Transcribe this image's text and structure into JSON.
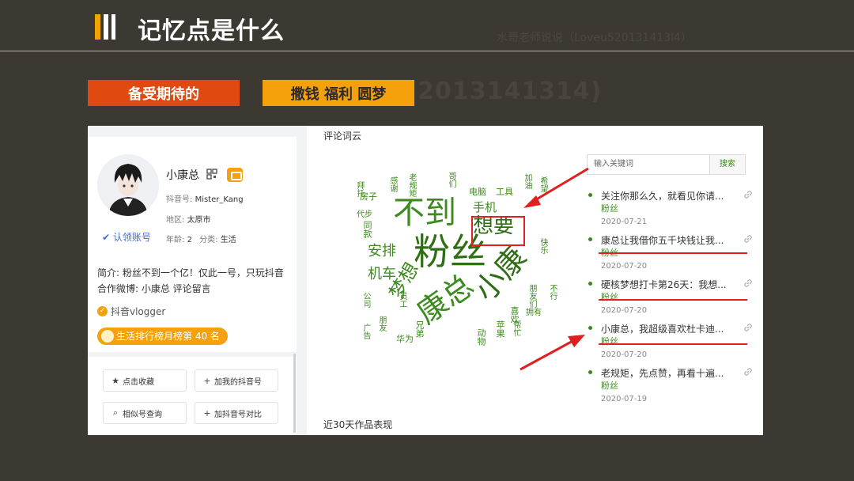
{
  "slide": {
    "title": "记忆点是什么",
    "watermark": "水哥老师说说（Loveu520131413l4）",
    "watermark_big": "2013141314)"
  },
  "tags": [
    {
      "label": "备受期待的",
      "color": "#e04a10"
    },
    {
      "label": "撒钱 福利 圆梦",
      "color": "#f4a10c"
    }
  ],
  "profile": {
    "name": "小康总",
    "douyin_id_label": "抖音号:",
    "douyin_id": "Mister_Kang",
    "region_label": "地区:",
    "region": "太原市",
    "age_label": "年龄:",
    "age": "2",
    "category_label": "分类:",
    "category": "生活",
    "claim_label": "认领账号",
    "bio": "简介: 粉丝不到一个亿！仅此一号，只玩抖音 合作微博: 小康总 评论留言",
    "vlog_label": "抖音vlogger",
    "rank_label": "生活排行榜月榜第 40 名",
    "actions": [
      {
        "icon": "star-icon",
        "label": "点击收藏"
      },
      {
        "icon": "plus-icon",
        "label": "加我的抖音号"
      },
      {
        "icon": "search-icon",
        "label": "相似号查询"
      },
      {
        "icon": "plus-icon",
        "label": "加抖音号对比"
      }
    ]
  },
  "wordcloud": {
    "section_title": "评论词云",
    "words": [
      "不到",
      "粉丝",
      "康总",
      "小康",
      "想要",
      "梦想",
      "安排",
      "机车",
      "手机",
      "电脑",
      "工具",
      "房子",
      "代步",
      "同款",
      "拜托",
      "老规矩",
      "感谢",
      "快乐",
      "拥有",
      "不行",
      "华为",
      "兄弟",
      "动物",
      "苹果",
      "喜欢",
      "员工",
      "公司",
      "朋友",
      "广告",
      "哥们",
      "加油",
      "希望",
      "帮忙",
      "朋友们"
    ],
    "highlighted_word": "想要"
  },
  "comments": {
    "search_placeholder": "输入关键词",
    "search_button": "搜索",
    "items": [
      {
        "text": "关注你那么久，就看见你请...",
        "tag": "粉丝",
        "date": "2020-07-21"
      },
      {
        "text": "康总让我借你五千块钱让我...",
        "tag": "粉丝",
        "date": "2020-07-20"
      },
      {
        "text": "硬核梦想打卡第26天：我想...",
        "tag": "粉丝",
        "date": "2020-07-20"
      },
      {
        "text": "小康总，我超级喜欢杜卡迪...",
        "tag": "粉丝",
        "date": "2020-07-20"
      },
      {
        "text": "老规矩，先点赞，再看十遍...",
        "tag": "粉丝",
        "date": "2020-07-19"
      }
    ]
  },
  "section2_title": "近30天作品表现",
  "colors": {
    "background": "#3c3832",
    "orange": "#f4a10c",
    "red_orange": "#e04a10",
    "green": "#3d8b1e",
    "annotation_red": "#e02020"
  }
}
